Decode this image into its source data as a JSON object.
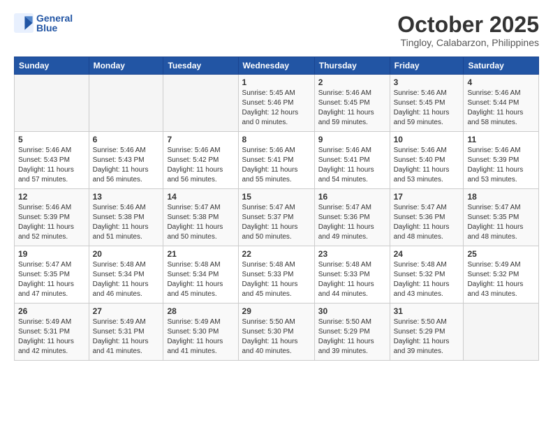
{
  "logo": {
    "line1": "General",
    "line2": "Blue"
  },
  "title": "October 2025",
  "subtitle": "Tingloy, Calabarzon, Philippines",
  "headers": [
    "Sunday",
    "Monday",
    "Tuesday",
    "Wednesday",
    "Thursday",
    "Friday",
    "Saturday"
  ],
  "weeks": [
    [
      {
        "day": "",
        "info": ""
      },
      {
        "day": "",
        "info": ""
      },
      {
        "day": "",
        "info": ""
      },
      {
        "day": "1",
        "info": "Sunrise: 5:45 AM\nSunset: 5:46 PM\nDaylight: 12 hours\nand 0 minutes."
      },
      {
        "day": "2",
        "info": "Sunrise: 5:46 AM\nSunset: 5:45 PM\nDaylight: 11 hours\nand 59 minutes."
      },
      {
        "day": "3",
        "info": "Sunrise: 5:46 AM\nSunset: 5:45 PM\nDaylight: 11 hours\nand 59 minutes."
      },
      {
        "day": "4",
        "info": "Sunrise: 5:46 AM\nSunset: 5:44 PM\nDaylight: 11 hours\nand 58 minutes."
      }
    ],
    [
      {
        "day": "5",
        "info": "Sunrise: 5:46 AM\nSunset: 5:43 PM\nDaylight: 11 hours\nand 57 minutes."
      },
      {
        "day": "6",
        "info": "Sunrise: 5:46 AM\nSunset: 5:43 PM\nDaylight: 11 hours\nand 56 minutes."
      },
      {
        "day": "7",
        "info": "Sunrise: 5:46 AM\nSunset: 5:42 PM\nDaylight: 11 hours\nand 56 minutes."
      },
      {
        "day": "8",
        "info": "Sunrise: 5:46 AM\nSunset: 5:41 PM\nDaylight: 11 hours\nand 55 minutes."
      },
      {
        "day": "9",
        "info": "Sunrise: 5:46 AM\nSunset: 5:41 PM\nDaylight: 11 hours\nand 54 minutes."
      },
      {
        "day": "10",
        "info": "Sunrise: 5:46 AM\nSunset: 5:40 PM\nDaylight: 11 hours\nand 53 minutes."
      },
      {
        "day": "11",
        "info": "Sunrise: 5:46 AM\nSunset: 5:39 PM\nDaylight: 11 hours\nand 53 minutes."
      }
    ],
    [
      {
        "day": "12",
        "info": "Sunrise: 5:46 AM\nSunset: 5:39 PM\nDaylight: 11 hours\nand 52 minutes."
      },
      {
        "day": "13",
        "info": "Sunrise: 5:46 AM\nSunset: 5:38 PM\nDaylight: 11 hours\nand 51 minutes."
      },
      {
        "day": "14",
        "info": "Sunrise: 5:47 AM\nSunset: 5:38 PM\nDaylight: 11 hours\nand 50 minutes."
      },
      {
        "day": "15",
        "info": "Sunrise: 5:47 AM\nSunset: 5:37 PM\nDaylight: 11 hours\nand 50 minutes."
      },
      {
        "day": "16",
        "info": "Sunrise: 5:47 AM\nSunset: 5:36 PM\nDaylight: 11 hours\nand 49 minutes."
      },
      {
        "day": "17",
        "info": "Sunrise: 5:47 AM\nSunset: 5:36 PM\nDaylight: 11 hours\nand 48 minutes."
      },
      {
        "day": "18",
        "info": "Sunrise: 5:47 AM\nSunset: 5:35 PM\nDaylight: 11 hours\nand 48 minutes."
      }
    ],
    [
      {
        "day": "19",
        "info": "Sunrise: 5:47 AM\nSunset: 5:35 PM\nDaylight: 11 hours\nand 47 minutes."
      },
      {
        "day": "20",
        "info": "Sunrise: 5:48 AM\nSunset: 5:34 PM\nDaylight: 11 hours\nand 46 minutes."
      },
      {
        "day": "21",
        "info": "Sunrise: 5:48 AM\nSunset: 5:34 PM\nDaylight: 11 hours\nand 45 minutes."
      },
      {
        "day": "22",
        "info": "Sunrise: 5:48 AM\nSunset: 5:33 PM\nDaylight: 11 hours\nand 45 minutes."
      },
      {
        "day": "23",
        "info": "Sunrise: 5:48 AM\nSunset: 5:33 PM\nDaylight: 11 hours\nand 44 minutes."
      },
      {
        "day": "24",
        "info": "Sunrise: 5:48 AM\nSunset: 5:32 PM\nDaylight: 11 hours\nand 43 minutes."
      },
      {
        "day": "25",
        "info": "Sunrise: 5:49 AM\nSunset: 5:32 PM\nDaylight: 11 hours\nand 43 minutes."
      }
    ],
    [
      {
        "day": "26",
        "info": "Sunrise: 5:49 AM\nSunset: 5:31 PM\nDaylight: 11 hours\nand 42 minutes."
      },
      {
        "day": "27",
        "info": "Sunrise: 5:49 AM\nSunset: 5:31 PM\nDaylight: 11 hours\nand 41 minutes."
      },
      {
        "day": "28",
        "info": "Sunrise: 5:49 AM\nSunset: 5:30 PM\nDaylight: 11 hours\nand 41 minutes."
      },
      {
        "day": "29",
        "info": "Sunrise: 5:50 AM\nSunset: 5:30 PM\nDaylight: 11 hours\nand 40 minutes."
      },
      {
        "day": "30",
        "info": "Sunrise: 5:50 AM\nSunset: 5:29 PM\nDaylight: 11 hours\nand 39 minutes."
      },
      {
        "day": "31",
        "info": "Sunrise: 5:50 AM\nSunset: 5:29 PM\nDaylight: 11 hours\nand 39 minutes."
      },
      {
        "day": "",
        "info": ""
      }
    ]
  ]
}
